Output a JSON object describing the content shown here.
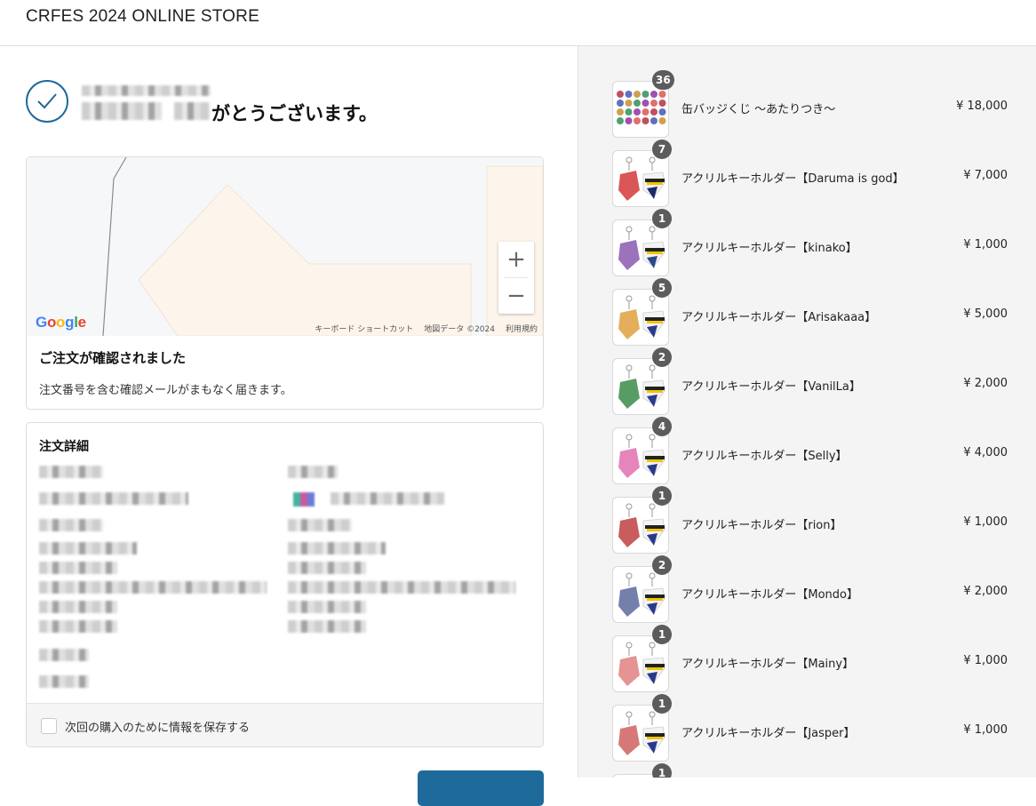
{
  "header": {
    "store_title": "CRFES 2024 ONLINE STORE"
  },
  "thanks": {
    "title_suffix": "がとうございます。"
  },
  "map": {
    "zoom_in": "+",
    "zoom_out": "−",
    "logo": "Google",
    "footer": [
      "キーボード ショートカット",
      "地図データ ©2024",
      "利用規約"
    ]
  },
  "confirmation": {
    "title": "ご注文が確認されました",
    "subtitle": "注文番号を含む確認メールがまもなく届きます。"
  },
  "details": {
    "title": "注文詳細",
    "save_label": "次回の購入のために情報を保存する"
  },
  "cart": {
    "items": [
      {
        "name": "缶バッジくじ ～あたりつき～",
        "price": "¥ 18,000",
        "qty": "36"
      },
      {
        "name": "アクリルキーホルダー【Daruma is god】",
        "price": "¥ 7,000",
        "qty": "7"
      },
      {
        "name": "アクリルキーホルダー【kinako】",
        "price": "¥ 1,000",
        "qty": "1"
      },
      {
        "name": "アクリルキーホルダー【Arisakaaa】",
        "price": "¥ 5,000",
        "qty": "5"
      },
      {
        "name": "アクリルキーホルダー【VanilLa】",
        "price": "¥ 2,000",
        "qty": "2"
      },
      {
        "name": "アクリルキーホルダー【Selly】",
        "price": "¥ 4,000",
        "qty": "4"
      },
      {
        "name": "アクリルキーホルダー【rion】",
        "price": "¥ 1,000",
        "qty": "1"
      },
      {
        "name": "アクリルキーホルダー【Mondo】",
        "price": "¥ 2,000",
        "qty": "2"
      },
      {
        "name": "アクリルキーホルダー【Mainy】",
        "price": "¥ 1,000",
        "qty": "1"
      },
      {
        "name": "アクリルキーホルダー【Jasper】",
        "price": "¥ 1,000",
        "qty": "1"
      },
      {
        "name": "",
        "price": "",
        "qty": "1"
      }
    ]
  },
  "colors": {
    "accent": "#1e6a9a",
    "badge": "#5c5c5c",
    "sidebar_bg": "#f4f4f4"
  },
  "icons": {
    "check": "check-icon",
    "zoom_in": "plus-icon",
    "zoom_out": "minus-icon"
  }
}
